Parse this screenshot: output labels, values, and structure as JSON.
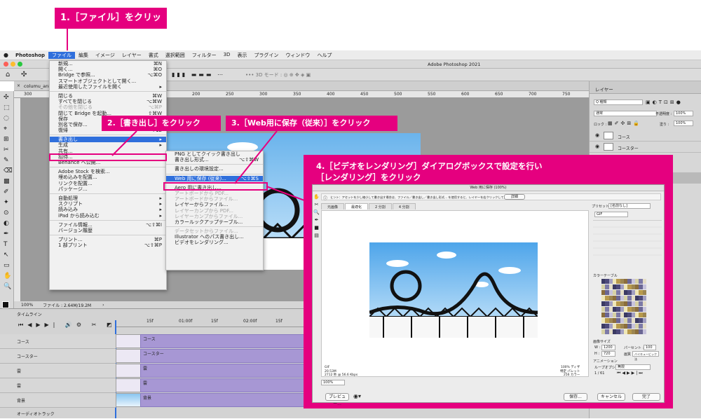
{
  "callouts": {
    "c1": "1.［ファイル］をクリック",
    "c2": "2.［書き出し］をクリック",
    "c3": "3.［Web用に保存（従来）］をクリック",
    "c4_line1": "4.［ビデオをレンダリング］ダイアログボックスで設定を行い",
    "c4_line2": "［レンダリング］をクリック"
  },
  "menubar": {
    "apple": "",
    "app": "Photoshop",
    "items": [
      "ファイル",
      "編集",
      "イメージ",
      "レイヤー",
      "書式",
      "選択範囲",
      "フィルター",
      "3D",
      "表示",
      "プラグイン",
      "ウィンドウ",
      "ヘルプ"
    ]
  },
  "window_title": "Adobe Photoshop 2021",
  "doc_tab": "columu_anim",
  "status": {
    "zoom": "100%",
    "file": "ファイル : 2.64M/19.2M"
  },
  "ruler_ticks": [
    "300",
    "0",
    "50",
    "100",
    "150",
    "200",
    "250",
    "300",
    "350",
    "400",
    "450",
    "500",
    "550",
    "600",
    "650",
    "700",
    "750"
  ],
  "file_menu": [
    {
      "l": "新規...",
      "s": "⌘N"
    },
    {
      "l": "開く...",
      "s": "⌘O"
    },
    {
      "l": "Bridge で参照...",
      "s": "⌥⌘O"
    },
    {
      "l": "スマートオブジェクトとして開く...",
      "s": ""
    },
    {
      "l": "最近使用したファイルを開く",
      "s": "▸"
    },
    {
      "sep": true
    },
    {
      "l": "閉じる",
      "s": "⌘W"
    },
    {
      "l": "すべてを閉じる",
      "s": "⌥⌘W"
    },
    {
      "l": "その他を閉じる",
      "s": "⌥⌘P",
      "d": true
    },
    {
      "l": "閉じて Bridge を起動...",
      "s": "⇧⌘W"
    },
    {
      "l": "保存",
      "s": "⌘S"
    },
    {
      "l": "別名で保存...",
      "s": "⇧⌘S"
    },
    {
      "l": "復帰",
      "s": "F12"
    },
    {
      "sep": true
    },
    {
      "l": "書き出し",
      "s": "▸",
      "h": true
    },
    {
      "l": "生成",
      "s": "▸"
    },
    {
      "l": "共有...",
      "s": ""
    },
    {
      "l": "招待...",
      "s": ""
    },
    {
      "l": "Behance へ公開...",
      "s": ""
    },
    {
      "sep": true
    },
    {
      "l": "Adobe Stock を検索...",
      "s": ""
    },
    {
      "l": "埋め込みを配置...",
      "s": ""
    },
    {
      "l": "リンクを配置...",
      "s": ""
    },
    {
      "l": "パッケージ...",
      "s": ""
    },
    {
      "sep": true
    },
    {
      "l": "自動処理",
      "s": "▸"
    },
    {
      "l": "スクリプト",
      "s": "▸"
    },
    {
      "l": "読み込み",
      "s": "▸"
    },
    {
      "l": "iPad から読み込む",
      "s": "▸"
    },
    {
      "sep": true
    },
    {
      "l": "ファイル情報...",
      "s": "⌥⇧⌘I"
    },
    {
      "l": "バージョン履歴",
      "s": ""
    },
    {
      "sep": true
    },
    {
      "l": "プリント...",
      "s": "⌘P"
    },
    {
      "l": "1 部プリント",
      "s": "⌥⇧⌘P"
    }
  ],
  "export_menu": [
    {
      "l": "PNG としてクイック書き出し",
      "s": ""
    },
    {
      "l": "書き出し形式...",
      "s": "⌥⇧⌘W"
    },
    {
      "sep": true
    },
    {
      "l": "書き出しの環境設定...",
      "s": ""
    },
    {
      "sep": true
    },
    {
      "l": "Web 用に保存 (従来)...",
      "s": "⌥⇧⌘S",
      "h": true
    },
    {
      "sep": true
    },
    {
      "l": "Aero 用に書き出し...",
      "s": ""
    },
    {
      "l": "アートボードから PDF...",
      "s": "",
      "d": true
    },
    {
      "l": "アートボードからファイル...",
      "s": "",
      "d": true
    },
    {
      "l": "レイヤーからファイル...",
      "s": ""
    },
    {
      "l": "レイヤーカンプから PDF...",
      "s": "",
      "d": true
    },
    {
      "l": "レイヤーカンプからファイル...",
      "s": "",
      "d": true
    },
    {
      "l": "カラールックアップテーブル...",
      "s": ""
    },
    {
      "sep": true
    },
    {
      "l": "データセットからファイル...",
      "s": "",
      "d": true
    },
    {
      "l": "Illustrator へのパス書き出し...",
      "s": ""
    },
    {
      "l": "ビデオをレンダリング...",
      "s": ""
    }
  ],
  "layers": {
    "title": "レイヤー",
    "kind": "Q 種類",
    "blend": "通常",
    "opacity_label": "不透明度 :",
    "opacity": "100%",
    "lock_label": "ロック :",
    "fill_label": "塗り :",
    "fill": "100%",
    "items": [
      "コース",
      "コースター"
    ]
  },
  "timeline": {
    "title": "タイムライン",
    "times": [
      "15f",
      "01:00f",
      "15f",
      "02:00f",
      "15f"
    ],
    "tracks": [
      "コース",
      "コースター",
      "雲",
      "雲",
      "背景"
    ],
    "clips": [
      "コース",
      "コースター",
      "雲",
      "雲",
      "背景"
    ],
    "audio": "オーディオトラック"
  },
  "dialog": {
    "title": "Web 用に保存 (100%)",
    "hint": "ヒント：アセットを少し縮小して書き出す場合は、ファイル／書き出し／書き出し形式... を使用すると、レイヤーを右クリックして試行...",
    "hint_btn": "詳細",
    "tabs": [
      "元画像",
      "最適化",
      "2 分割",
      "4 分割"
    ],
    "preset_label": "プリセット :",
    "preset": "[名前なし]",
    "format": "GIF",
    "footer_left": [
      "GIF",
      "20.53M",
      "2712 秒 @ 56.6 Kbps"
    ],
    "footer_right": [
      "100% ディザ",
      "特定 パレット",
      "256 カラー"
    ],
    "zoom": "100%",
    "color_table_label": "カラーテーブル",
    "image_size_label": "画像サイズ",
    "w_label": "W :",
    "w": "1200",
    "h_label": "H :",
    "h": "720",
    "pct_label": "パーセント :",
    "pct": "100",
    "quality_label": "画質 :",
    "quality": "バイキュービック法",
    "anim_label": "アニメーション",
    "loop_label": "ループオプション :",
    "loop": "無限",
    "frame": "1 / 61",
    "buttons": {
      "preview": "プレビュー...",
      "save": "保存...",
      "cancel": "キャンセル",
      "done": "完了"
    }
  }
}
